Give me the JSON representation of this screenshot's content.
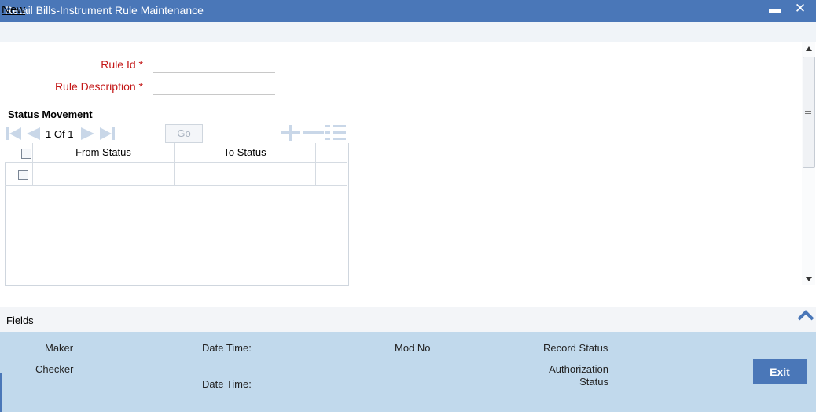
{
  "window": {
    "title": "Retail Bills-Instrument Rule Maintenance",
    "minimize_glyph": "▬",
    "close_glyph": "✕"
  },
  "toolbar": {
    "new_label": "New"
  },
  "form": {
    "rule_id_label": "Rule Id",
    "rule_description_label": "Rule Description",
    "required_mark": "*",
    "rule_id_value": "",
    "rule_description_value": ""
  },
  "status_movement": {
    "title": "Status Movement",
    "current_page": "1",
    "of_label": "Of",
    "total_pages": "1",
    "go_label": "Go",
    "columns": [
      "From Status",
      "To Status"
    ]
  },
  "footer": {
    "fields_label": "Fields",
    "maker_label": "Maker",
    "checker_label": "Checker",
    "date_time_label_1": "Date Time:",
    "date_time_label_2": "Date Time:",
    "mod_no_label": "Mod No",
    "record_status_label": "Record Status",
    "authorization_label": "Authorization",
    "status_label": "Status",
    "exit_label": "Exit"
  },
  "colors": {
    "titlebar": "#4a77b8",
    "footer": "#c1d9ec",
    "label_red": "#c41818"
  },
  "icons": [
    "first-page-icon",
    "previous-page-icon",
    "next-page-icon",
    "last-page-icon",
    "add-row-icon",
    "delete-row-icon",
    "view-rows-icon",
    "collapse-chevron-icon"
  ]
}
